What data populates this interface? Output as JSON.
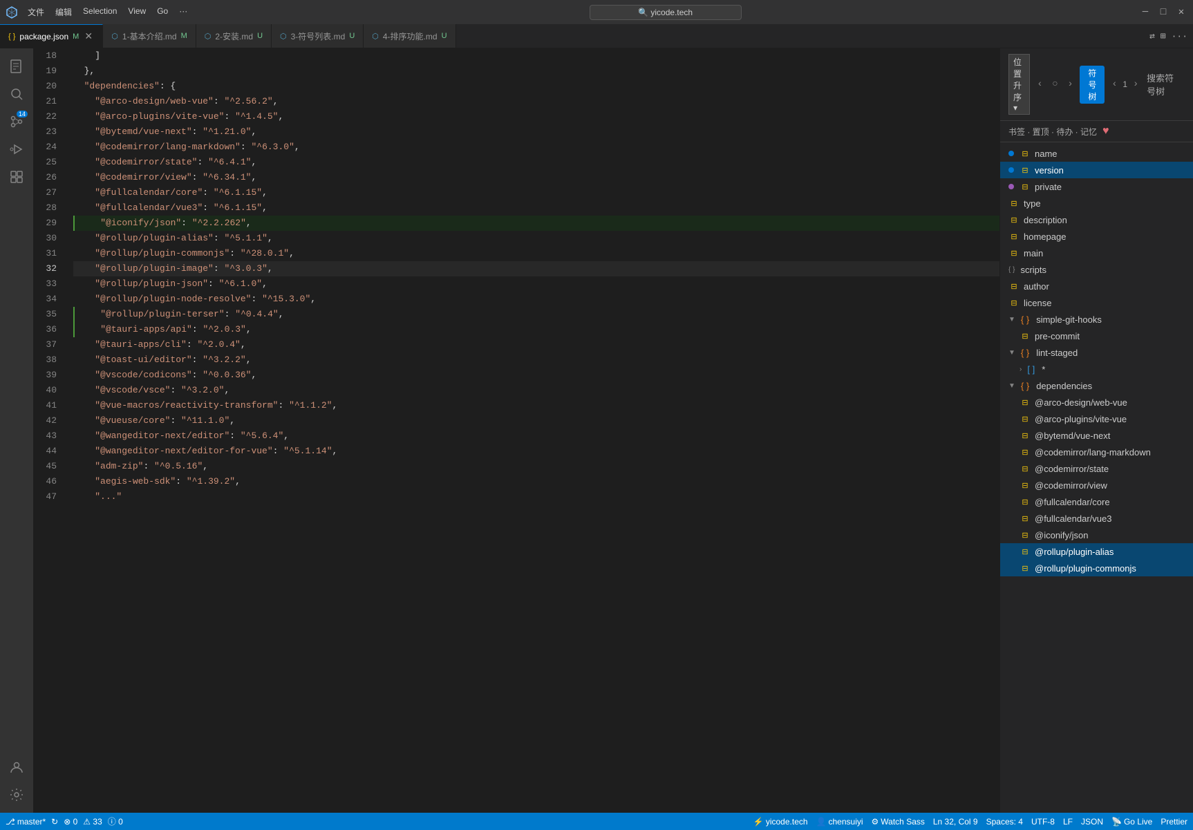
{
  "titleBar": {
    "icon": "⬡",
    "menu": [
      "文件",
      "编辑",
      "Selection",
      "View",
      "Go",
      "···"
    ],
    "search": "yicode.tech",
    "windowControls": [
      "─",
      "□",
      "✕"
    ]
  },
  "tabs": [
    {
      "label": "{ } package.json",
      "badge": "M",
      "active": true,
      "closable": true
    },
    {
      "label": "1-基本介绍.md",
      "badge": "M",
      "active": false,
      "closable": false
    },
    {
      "label": "2-安装.md",
      "badge": "U",
      "active": false,
      "closable": false
    },
    {
      "label": "3-符号列表.md",
      "badge": "U",
      "active": false,
      "closable": false
    },
    {
      "label": "4-排序功能.md",
      "badge": "U",
      "active": false,
      "closable": false
    }
  ],
  "activityBar": {
    "icons": [
      {
        "name": "explorer",
        "symbol": "📄",
        "active": false
      },
      {
        "name": "search",
        "symbol": "🔍",
        "active": false
      },
      {
        "name": "source-control",
        "symbol": "⑂",
        "badge": "14",
        "active": false
      },
      {
        "name": "run",
        "symbol": "▷",
        "active": false
      },
      {
        "name": "extensions",
        "symbol": "⊞",
        "active": false
      }
    ],
    "bottomIcons": [
      {
        "name": "account",
        "symbol": "👤"
      },
      {
        "name": "settings",
        "symbol": "⚙"
      }
    ]
  },
  "codeLines": [
    {
      "num": 18,
      "content": "    ]",
      "indent": 0
    },
    {
      "num": 19,
      "content": "  },",
      "indent": 0
    },
    {
      "num": 20,
      "content": "  \"dependencies\": {",
      "indent": 0,
      "isKey": true
    },
    {
      "num": 21,
      "content": "    \"@arco-design/web-vue\": \"^2.56.2\",",
      "indent": 4
    },
    {
      "num": 22,
      "content": "    \"@arco-plugins/vite-vue\": \"^1.4.5\",",
      "indent": 4
    },
    {
      "num": 23,
      "content": "    \"@bytemd/vue-next\": \"^1.21.0\",",
      "indent": 4
    },
    {
      "num": 24,
      "content": "    \"@codemirror/lang-markdown\": \"^6.3.0\",",
      "indent": 4
    },
    {
      "num": 25,
      "content": "    \"@codemirror/state\": \"^6.4.1\",",
      "indent": 4
    },
    {
      "num": 26,
      "content": "    \"@codemirror/view\": \"^6.34.1\",",
      "indent": 4
    },
    {
      "num": 27,
      "content": "    \"@fullcalendar/core\": \"^6.1.15\",",
      "indent": 4
    },
    {
      "num": 28,
      "content": "    \"@fullcalendar/vue3\": \"^6.1.15\",",
      "indent": 4
    },
    {
      "num": 29,
      "content": "    \"@iconify/json\": \"^2.2.262\",",
      "indent": 4,
      "highlighted": true
    },
    {
      "num": 30,
      "content": "    \"@rollup/plugin-alias\": \"^5.1.1\",",
      "indent": 4
    },
    {
      "num": 31,
      "content": "    \"@rollup/plugin-commonjs\": \"^28.0.1\",",
      "indent": 4
    },
    {
      "num": 32,
      "content": "    \"@rollup/plugin-image\": \"^3.0.3\",",
      "indent": 4,
      "active": true
    },
    {
      "num": 33,
      "content": "    \"@rollup/plugin-json\": \"^6.1.0\",",
      "indent": 4
    },
    {
      "num": 34,
      "content": "    \"@rollup/plugin-node-resolve\": \"^15.3.0\",",
      "indent": 4
    },
    {
      "num": 35,
      "content": "    \"@rollup/plugin-terser\": \"^0.4.4\",",
      "indent": 4,
      "highlighted2": true
    },
    {
      "num": 36,
      "content": "    \"@tauri-apps/api\": \"^2.0.3\",",
      "indent": 4,
      "highlighted2": true
    },
    {
      "num": 37,
      "content": "    \"@tauri-apps/cli\": \"^2.0.4\",",
      "indent": 4
    },
    {
      "num": 38,
      "content": "    \"@toast-ui/editor\": \"^3.2.2\",",
      "indent": 4
    },
    {
      "num": 39,
      "content": "    \"@vscode/codicons\": \"^0.0.36\",",
      "indent": 4
    },
    {
      "num": 40,
      "content": "    \"@vscode/vsce\": \"^3.2.0\",",
      "indent": 4
    },
    {
      "num": 41,
      "content": "    \"@vue-macros/reactivity-transform\": \"^1.1.2\",",
      "indent": 4
    },
    {
      "num": 42,
      "content": "    \"@vueuse/core\": \"^11.1.0\",",
      "indent": 4
    },
    {
      "num": 43,
      "content": "    \"@wangeditor-next/editor\": \"^5.6.4\",",
      "indent": 4
    },
    {
      "num": 44,
      "content": "    \"@wangeditor-next/editor-for-vue\": \"^5.1.14\",",
      "indent": 4
    },
    {
      "num": 45,
      "content": "    \"adm-zip\": \"^0.5.16\",",
      "indent": 4
    },
    {
      "num": 46,
      "content": "    \"aegis-web-sdk\": \"^1.39.2\",",
      "indent": 4
    },
    {
      "num": 47,
      "content": "    \"...",
      "indent": 4
    }
  ],
  "rightPanel": {
    "positionLabel": "位置升序",
    "searchLabel": "搜索符号树",
    "navLeft": "‹",
    "navRefresh": "○",
    "navRight": "›",
    "activeTab": "符号树",
    "navNum": "1",
    "subHeader": "书签 · 置顶 · 待办 · 记忆",
    "heartIcon": "♥",
    "treeItems": [
      {
        "label": "name",
        "type": "bracket",
        "indent": 0,
        "id": "name"
      },
      {
        "label": "version",
        "type": "bracket",
        "indent": 0,
        "selected": true,
        "id": "version"
      },
      {
        "label": "private",
        "type": "bracket",
        "indent": 0,
        "id": "private"
      },
      {
        "label": "type",
        "type": "bracket",
        "indent": 0,
        "id": "type"
      },
      {
        "label": "description",
        "type": "bracket",
        "indent": 0,
        "id": "description"
      },
      {
        "label": "homepage",
        "type": "bracket",
        "indent": 0,
        "id": "homepage"
      },
      {
        "label": "main",
        "type": "bracket",
        "indent": 0,
        "id": "main"
      },
      {
        "label": "scripts",
        "type": "curly",
        "indent": 0,
        "id": "scripts"
      },
      {
        "label": "author",
        "type": "bracket",
        "indent": 0,
        "id": "author"
      },
      {
        "label": "license",
        "type": "bracket",
        "indent": 0,
        "id": "license"
      },
      {
        "label": "simple-git-hooks",
        "type": "curly",
        "indent": 0,
        "expanded": true,
        "chevron": "▼",
        "id": "simple-git-hooks"
      },
      {
        "label": "pre-commit",
        "type": "bracket",
        "indent": 1,
        "id": "pre-commit"
      },
      {
        "label": "lint-staged",
        "type": "curly",
        "indent": 0,
        "expanded": true,
        "chevron": "▼",
        "id": "lint-staged"
      },
      {
        "label": "[ ] *",
        "type": "square",
        "indent": 1,
        "chevron": "›",
        "id": "lint-staged-array"
      },
      {
        "label": "dependencies",
        "type": "curly",
        "indent": 0,
        "expanded": true,
        "chevron": "▼",
        "id": "dependencies"
      },
      {
        "label": "@arco-design/web-vue",
        "type": "bracket",
        "indent": 1,
        "id": "arco-design"
      },
      {
        "label": "@arco-plugins/vite-vue",
        "type": "bracket",
        "indent": 1,
        "id": "arco-plugins"
      },
      {
        "label": "@bytemd/vue-next",
        "type": "bracket",
        "indent": 1,
        "id": "bytemd"
      },
      {
        "label": "@codemirror/lang-markdown",
        "type": "bracket",
        "indent": 1,
        "id": "codemirror-lang"
      },
      {
        "label": "@codemirror/state",
        "type": "bracket",
        "indent": 1,
        "id": "codemirror-state"
      },
      {
        "label": "@codemirror/view",
        "type": "bracket",
        "indent": 1,
        "id": "codemirror-view"
      },
      {
        "label": "@fullcalendar/core",
        "type": "bracket",
        "indent": 1,
        "id": "fullcalendar-core"
      },
      {
        "label": "@fullcalendar/vue3",
        "type": "bracket",
        "indent": 1,
        "id": "fullcalendar-vue3"
      },
      {
        "label": "@iconify/json",
        "type": "bracket",
        "indent": 1,
        "id": "iconify"
      },
      {
        "label": "@rollup/plugin-alias",
        "type": "bracket",
        "indent": 1,
        "selected2": true,
        "id": "rollup-alias"
      },
      {
        "label": "@rollup/plugin-commonjs",
        "type": "bracket",
        "indent": 1,
        "selected2": true,
        "id": "rollup-commonjs"
      }
    ]
  },
  "statusBar": {
    "branch": "master*",
    "sync": "↻",
    "errors": "⊗ 0",
    "warnings": "⚠ 33",
    "info": "ⓘ 0",
    "remote": "yicode.tech",
    "user": "chensuiyi",
    "watch": "Watch Sass",
    "position": "Ln 32, Col 9",
    "spaces": "Spaces: 4",
    "encoding": "UTF-8",
    "eol": "LF",
    "language": "JSON",
    "goLive": "Go Live",
    "prettier": "Prettier"
  }
}
